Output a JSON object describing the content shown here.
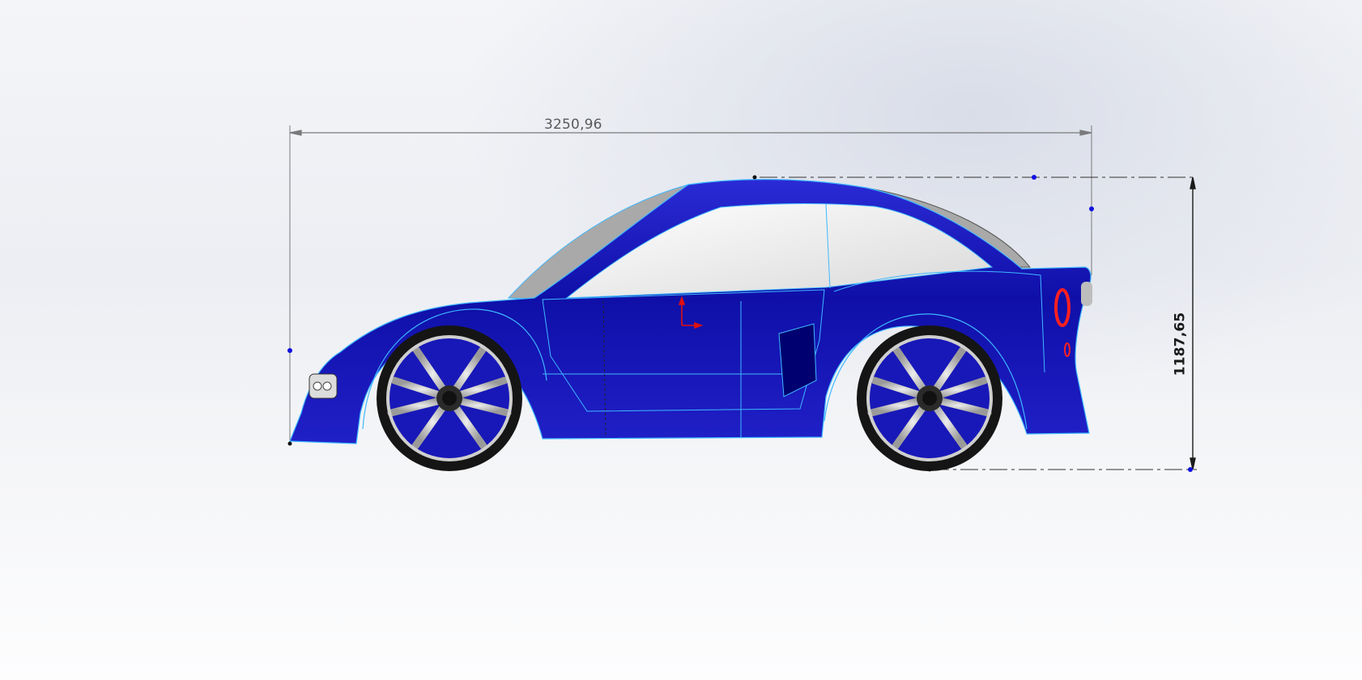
{
  "view": {
    "name": "cad-side-view",
    "colors": {
      "body": "#1818b8",
      "body_dark": "#000080",
      "body_light": "#3c3cf0",
      "edge": "#3fb8ff",
      "glass": "#f2f2f2",
      "roof_side": "#a8a8a8",
      "dimension": "#7a7a7a",
      "dimension_dark": "#1a1a1a",
      "point": "#1010e0",
      "origin_axis": "#e01010",
      "tire": "#151515",
      "rim": "#cfcfcf"
    }
  },
  "dimensions": {
    "overall_length": "3250,96",
    "overall_height": "1187,65"
  }
}
